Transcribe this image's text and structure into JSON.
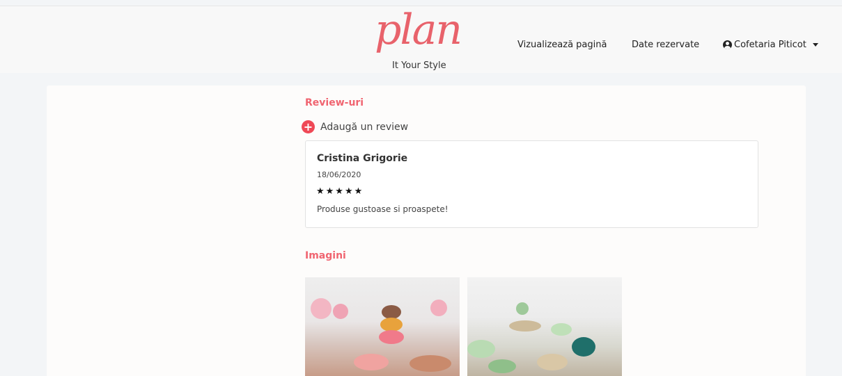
{
  "navbar": {
    "logo_script": "plan",
    "logo_tagline": "It Your Style",
    "links": [
      {
        "label": "Vizualizează pagină"
      },
      {
        "label": "Date rezervate"
      }
    ],
    "user": {
      "label": "Cofetaria Piticot",
      "icon": "user-circle-icon"
    }
  },
  "reviews": {
    "title": "Review-uri",
    "add_label": "Adaugă un review",
    "items": [
      {
        "author": "Cristina Grigorie",
        "date": "18/06/2020",
        "stars": "★★★★★",
        "rating": 5,
        "text": "Produse gustoase si proaspete!"
      }
    ]
  },
  "images": {
    "title": "Imagini",
    "items": [
      {
        "name": "candy-bar-pink"
      },
      {
        "name": "candy-bar-green"
      }
    ]
  },
  "colors": {
    "accent": "#f06470",
    "logo": "#e8626b",
    "add_button": "#ef4856"
  }
}
